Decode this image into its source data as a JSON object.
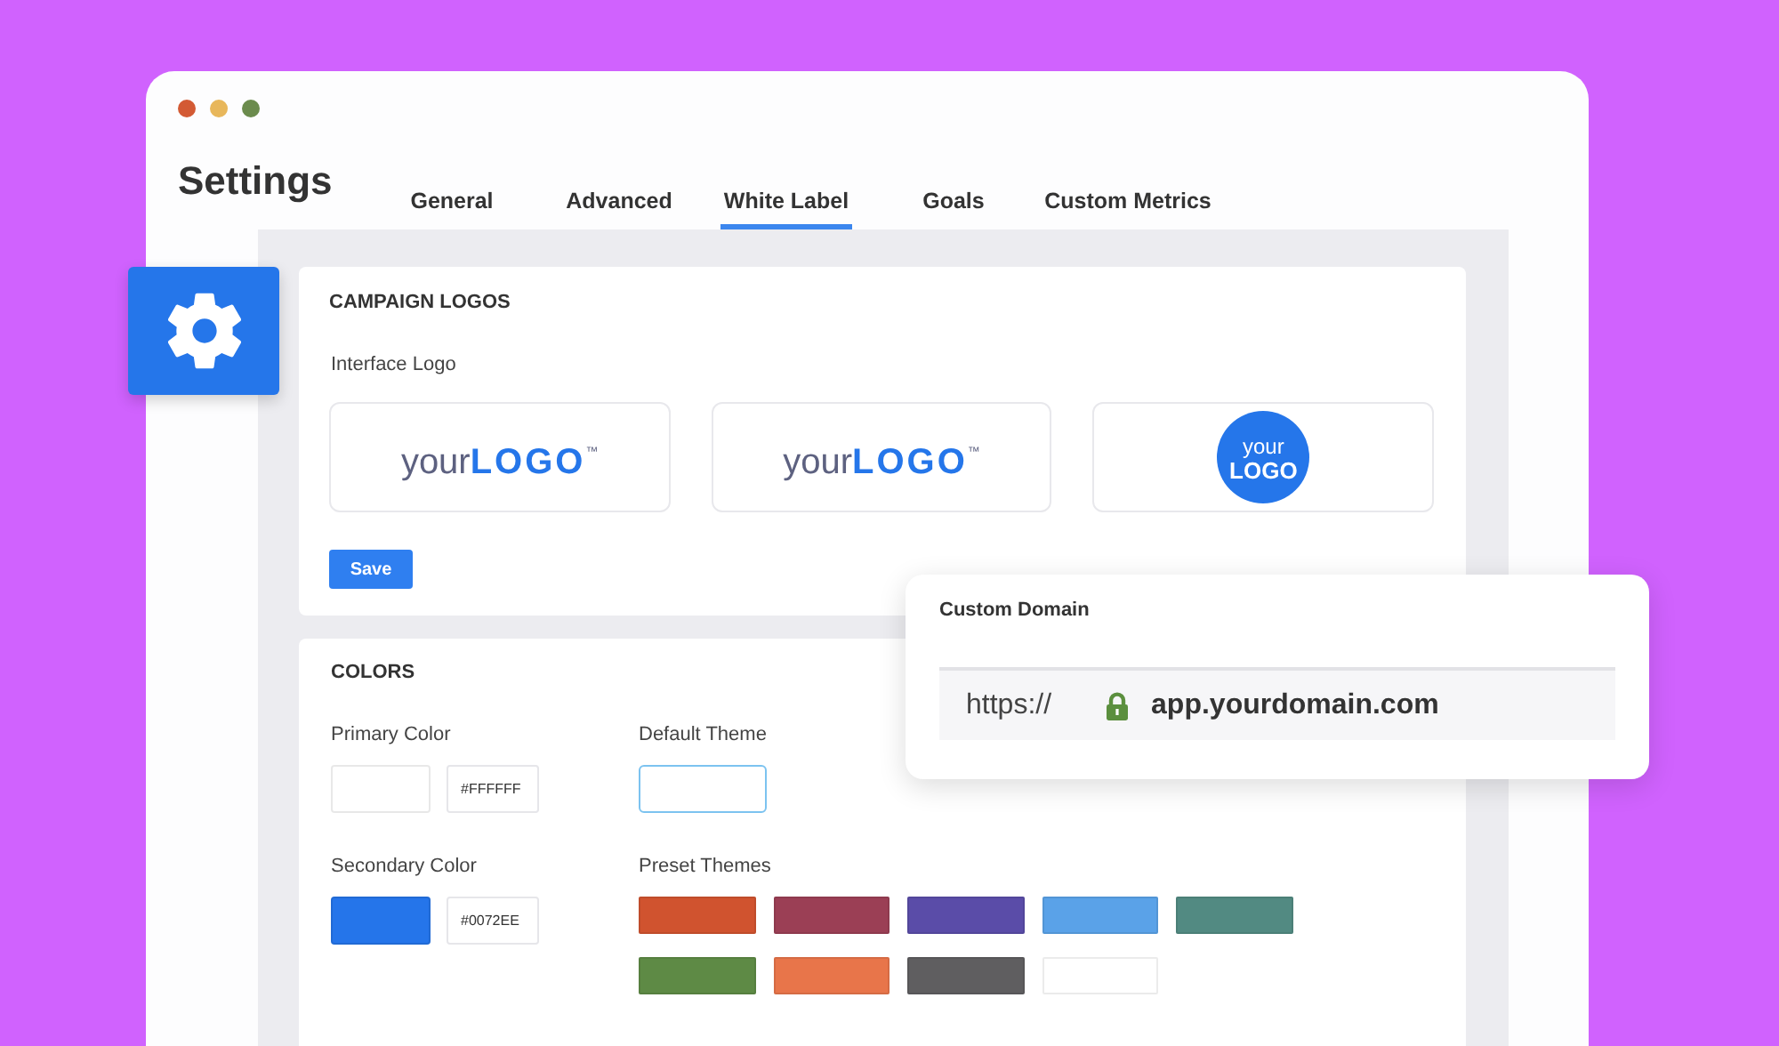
{
  "window": {
    "title": "Settings",
    "controls": [
      {
        "color": "#d35a34"
      },
      {
        "color": "#e8b75b"
      },
      {
        "color": "#6b8b4d"
      }
    ]
  },
  "tabs": [
    {
      "label": "General",
      "selected": false
    },
    {
      "label": "Advanced",
      "selected": false
    },
    {
      "label": "White Label",
      "selected": true
    },
    {
      "label": "Goals",
      "selected": false
    },
    {
      "label": "Custom Metrics",
      "selected": false
    }
  ],
  "campaign_logos": {
    "heading": "CAMPAIGN LOGOS",
    "label": "Interface Logo",
    "logos": [
      {
        "kind": "wordmark",
        "text": "your**LOGO**$^{™}$"
      },
      {
        "kind": "wordmark",
        "text": "your**LOGO**$^{™}$"
      },
      {
        "kind": "badge",
        "line_1": "your",
        "line_2": "LOGO"
      }
    ],
    "save_button": "Save"
  },
  "colors": {
    "heading": "COLORS",
    "primary": {
      "label": "Primary Color",
      "color": "#ffffff",
      "hex": "#FFFFFF"
    },
    "secondary": {
      "label": "Secondary Color",
      "color": "#2575ea",
      "hex": "#0072EE"
    },
    "default_theme": {
      "label": "Default Theme",
      "focused": true
    },
    "preset_themes": {
      "label": "Preset Themes",
      "swatches": [
        {
          "color": "#d0532f"
        },
        {
          "color": "#9b3f55"
        },
        {
          "color": "#5a4ca8"
        },
        {
          "color": "#5aa2e8"
        },
        {
          "color": "#528a82"
        },
        {
          "color": "#5e8a45"
        },
        {
          "color": "#e8754a"
        },
        {
          "color": "#5f5e60"
        },
        {
          "color": "#ffffff"
        }
      ]
    }
  },
  "custom_domain": {
    "title": "Custom Domain",
    "prefix": "https://",
    "secure": true,
    "value": "app.yourdomain.com"
  }
}
